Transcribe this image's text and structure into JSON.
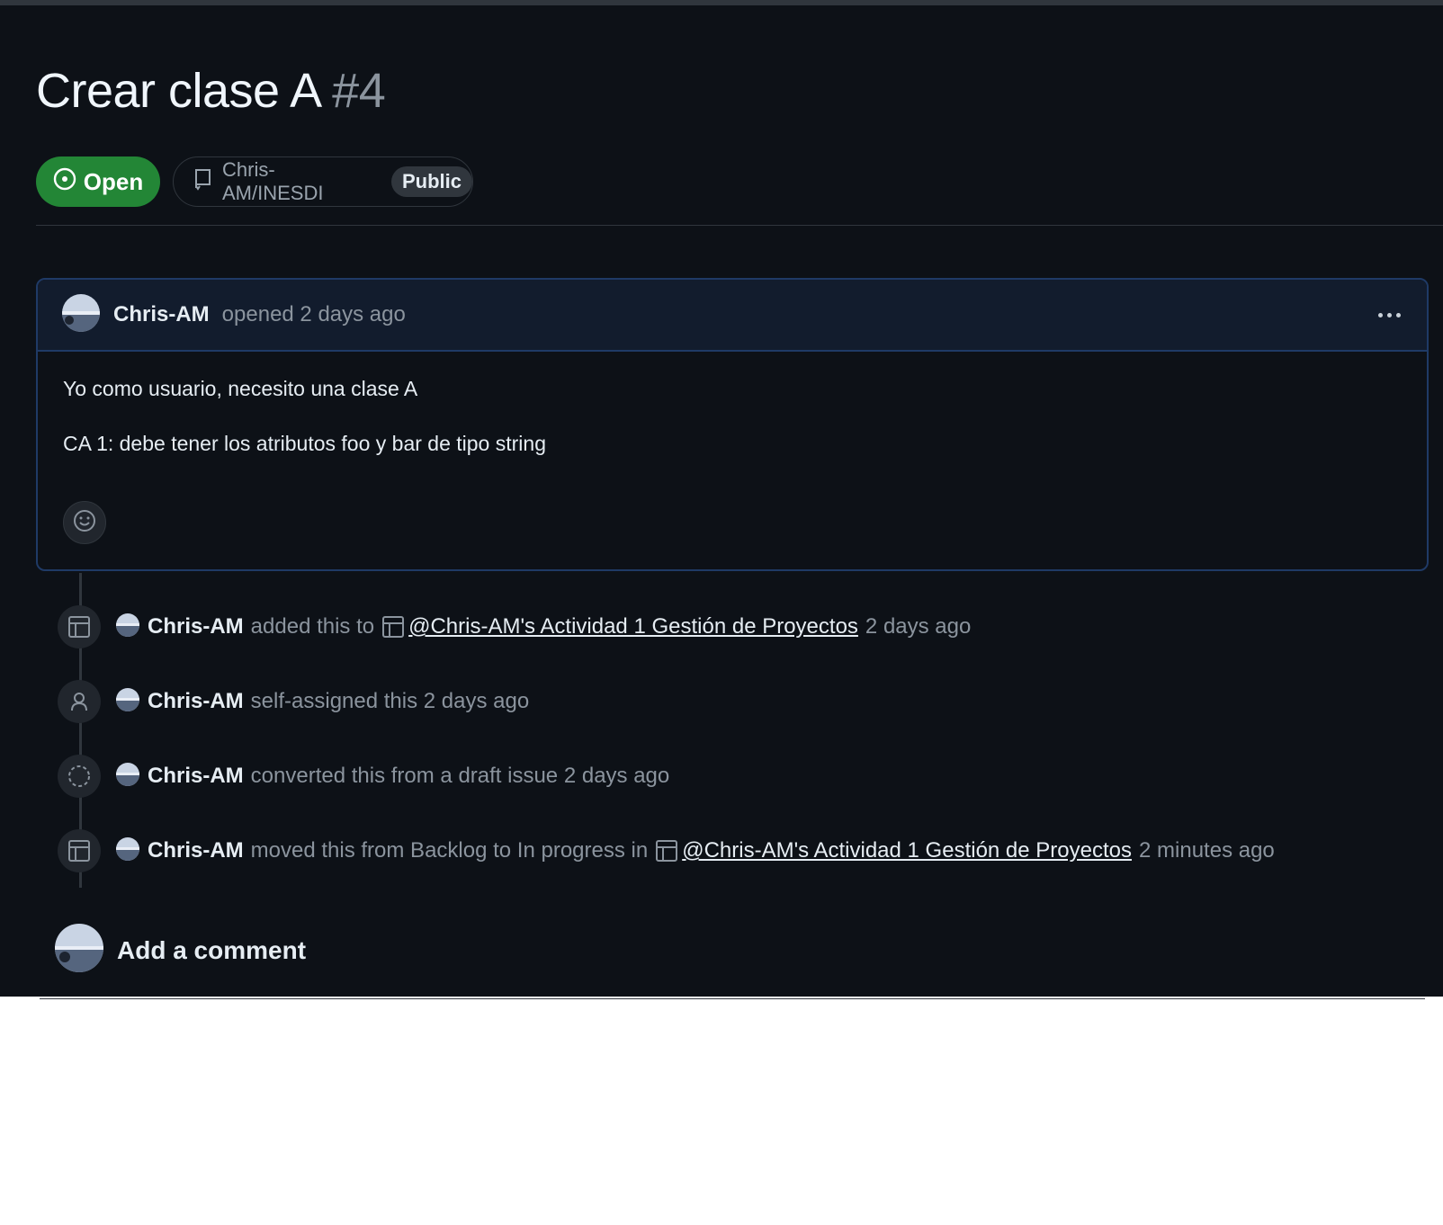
{
  "issue": {
    "title": "Crear clase A",
    "number": "#4",
    "state_label": "Open",
    "repo": "Chris-AM/INESDI",
    "visibility": "Public"
  },
  "comment": {
    "author": "Chris-AM",
    "meta": "opened 2 days ago",
    "body_line1": "Yo como usuario, necesito una clase A",
    "body_line2": "CA 1: debe tener los atributos foo y bar de tipo string"
  },
  "timeline": [
    {
      "icon": "project-table-icon",
      "author": "Chris-AM",
      "text": "added this to",
      "project": "@Chris-AM's Actividad 1 Gestión de Proyectos",
      "time": "2 days ago"
    },
    {
      "icon": "person-icon",
      "author": "Chris-AM",
      "text": "self-assigned this 2 days ago"
    },
    {
      "icon": "draft-issue-icon",
      "author": "Chris-AM",
      "text": "converted this from a draft issue 2 days ago"
    },
    {
      "icon": "project-table-icon",
      "author": "Chris-AM",
      "text": "moved this from Backlog to In progress in",
      "project": "@Chris-AM's Actividad 1 Gestión de Proyectos",
      "time": "2 minutes ago"
    }
  ],
  "add_comment": {
    "label": "Add a comment"
  },
  "colors": {
    "background": "#0d1117",
    "open_green": "#238636",
    "header_blue": "#121c2d",
    "border_blue": "#1f3a66",
    "muted": "#8b949e"
  }
}
